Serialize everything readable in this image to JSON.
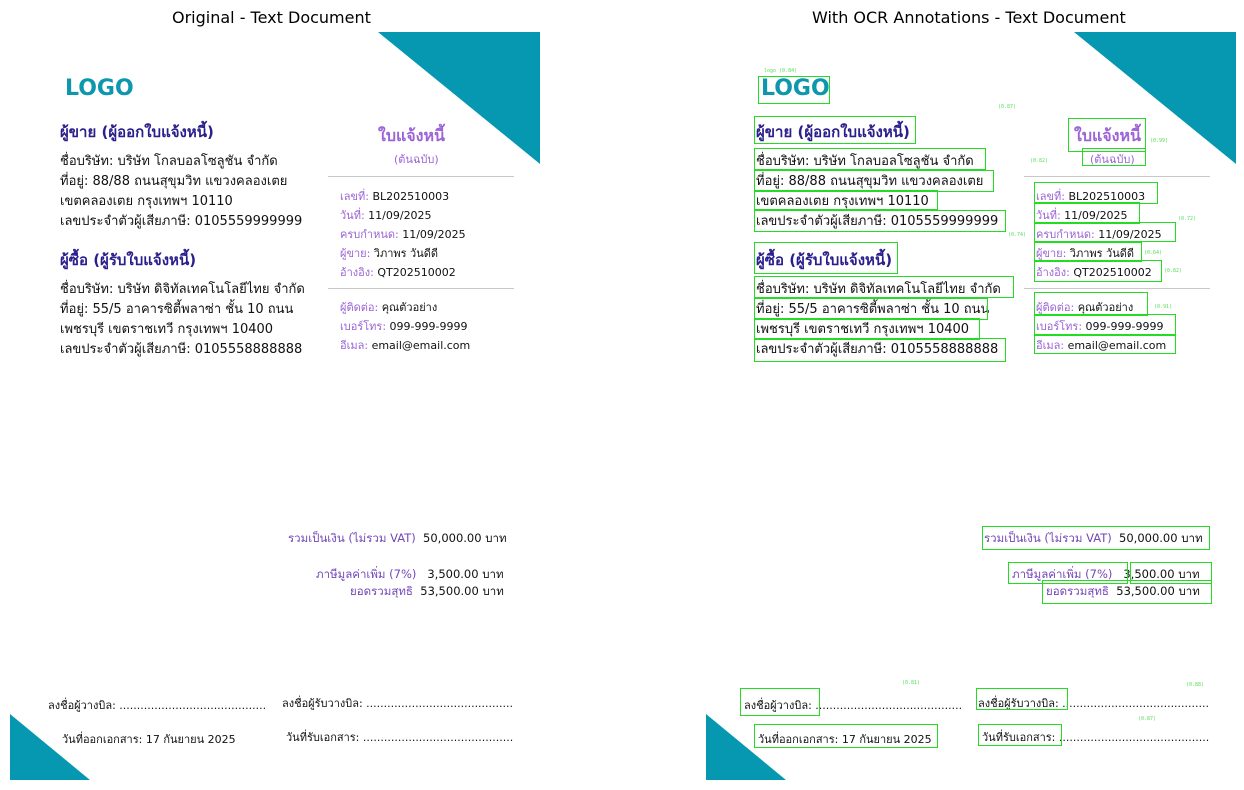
{
  "panels": {
    "left_title": "Original - Text Document",
    "right_title": "With OCR Annotations - Text Document"
  },
  "colors": {
    "accent": "#0698b0",
    "heading": "#2a1e8c",
    "label": "#9b64d6",
    "box": "#22dd22"
  },
  "document": {
    "logo": "LOGO",
    "seller_heading": "ผู้ขาย (ผู้ออกใบแจ้งหนี้)",
    "seller_lines": [
      "ชื่อบริษัท: บริษัท โกลบอลโซลูชัน จำกัด",
      "ที่อยู่: 88/88 ถนนสุขุมวิท แขวงคลองเตย",
      "เขตคลองเตย กรุงเทพฯ 10110",
      "เลขประจำตัวผู้เสียภาษี: 0105559999999"
    ],
    "buyer_heading": "ผู้ซื้อ (ผู้รับใบแจ้งหนี้)",
    "buyer_lines": [
      "ชื่อบริษัท: บริษัท ดิจิทัลเทคโนโลยีไทย จำกัด",
      "ที่อยู่: 55/5 อาคารซิตี้พลาซ่า ชั้น 10 ถนน",
      "เพชรบุรี เขตราชเทวี กรุงเทพฯ 10400",
      "เลขประจำตัวผู้เสียภาษี: 0105558888888"
    ],
    "invoice_title": "ใบแจ้งหนี้",
    "invoice_subtitle": "(ต้นฉบับ)",
    "meta": [
      {
        "label": "เลขที่:",
        "value": "BL202510003"
      },
      {
        "label": "วันที่:",
        "value": "11/09/2025"
      },
      {
        "label": "ครบกำหนด:",
        "value": "11/09/2025"
      },
      {
        "label": "ผู้ขาย:",
        "value": "วิภาพร วันดีดี"
      },
      {
        "label": "อ้างอิง:",
        "value": "QT202510002"
      }
    ],
    "contact": [
      {
        "label": "ผู้ติดต่อ:",
        "value": "คุณตัวอย่าง"
      },
      {
        "label": "เบอร์โทร:",
        "value": "099-999-9999"
      },
      {
        "label": "อีเมล:",
        "value": "email@email.com"
      }
    ],
    "totals": [
      {
        "label": "รวมเป็นเงิน (ไม่รวม VAT)",
        "value": "50,000.00 บาท"
      },
      {
        "label": "ภาษีมูลค่าเพิ่ม (7%)",
        "value": "3,500.00 บาท"
      },
      {
        "label": "ยอดรวมสุทธิ",
        "value": "53,500.00 บาท"
      }
    ],
    "signatures": {
      "biller": "ลงชื่อผู้วางบิล: ..........................................",
      "receiver": "ลงชื่อผู้รับวางบิล: ..........................................",
      "issue_date": "วันที่ออกเอกสาร: 17 กันยายน 2025",
      "receive_date": "วันที่รับเอกสาร: ..........................................."
    }
  },
  "ocr_annotations": [
    "logo (0.84)",
    "(0.87)",
    "(0.99)",
    "(0.82)",
    "(0.74)",
    "(0.72)",
    "(0.64)",
    "(0.82)",
    "(0.91)",
    "(0.81)",
    "(0.88)",
    "(0.87)"
  ]
}
